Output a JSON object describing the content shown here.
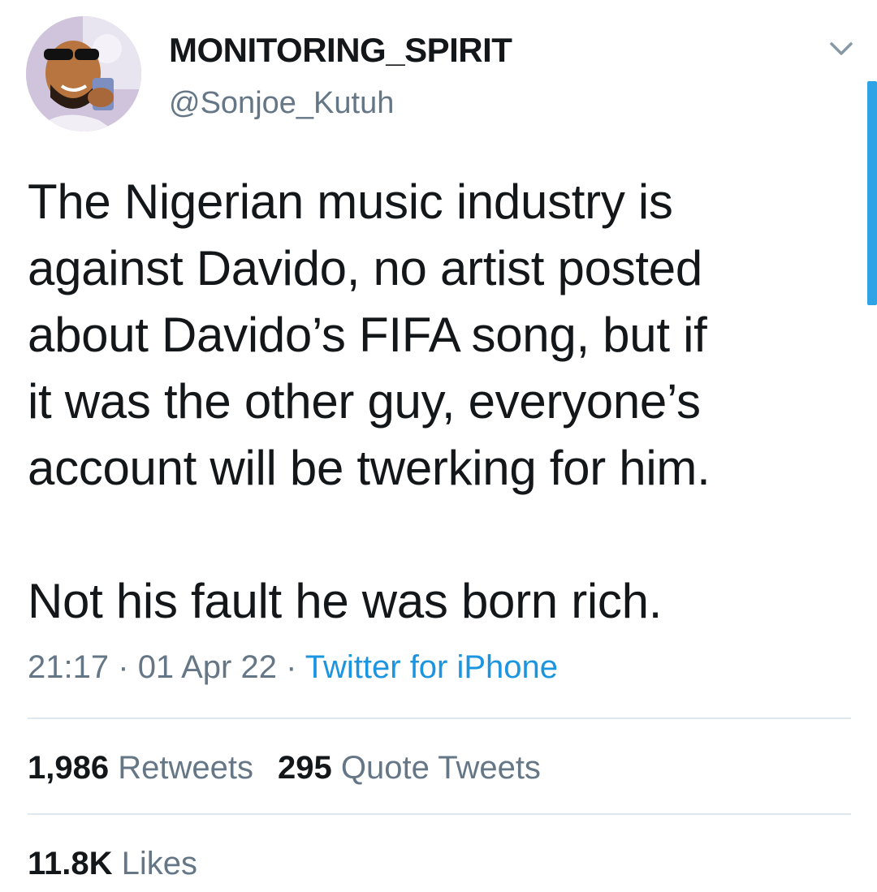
{
  "tweet": {
    "display_name": "MONITORING_SPIRIT",
    "handle": "@Sonjoe_Kutuh",
    "text_lines": [
      "The Nigerian music industry is",
      "against Davido, no artist posted",
      "about Davido’s FIFA song, but if",
      "it was the other guy, everyone’s",
      "account will be twerking for him."
    ],
    "text_line2": "Not his fault he was born rich.",
    "time": "21:17",
    "separator": "·",
    "date": "01 Apr 22",
    "source": "Twitter for iPhone",
    "retweets_count": "1,986",
    "retweets_label": "Retweets",
    "quotes_count": "295",
    "quotes_label": "Quote Tweets",
    "likes_count": "11.8K",
    "likes_label": "Likes"
  },
  "icons": {
    "menu": "chevron-down-icon",
    "avatar": "profile-photo"
  },
  "colors": {
    "text": "#14171a",
    "secondary": "#657786",
    "link": "#1b95e0",
    "divider": "#e1e8ed",
    "scrollbar": "#2fa3e6"
  }
}
